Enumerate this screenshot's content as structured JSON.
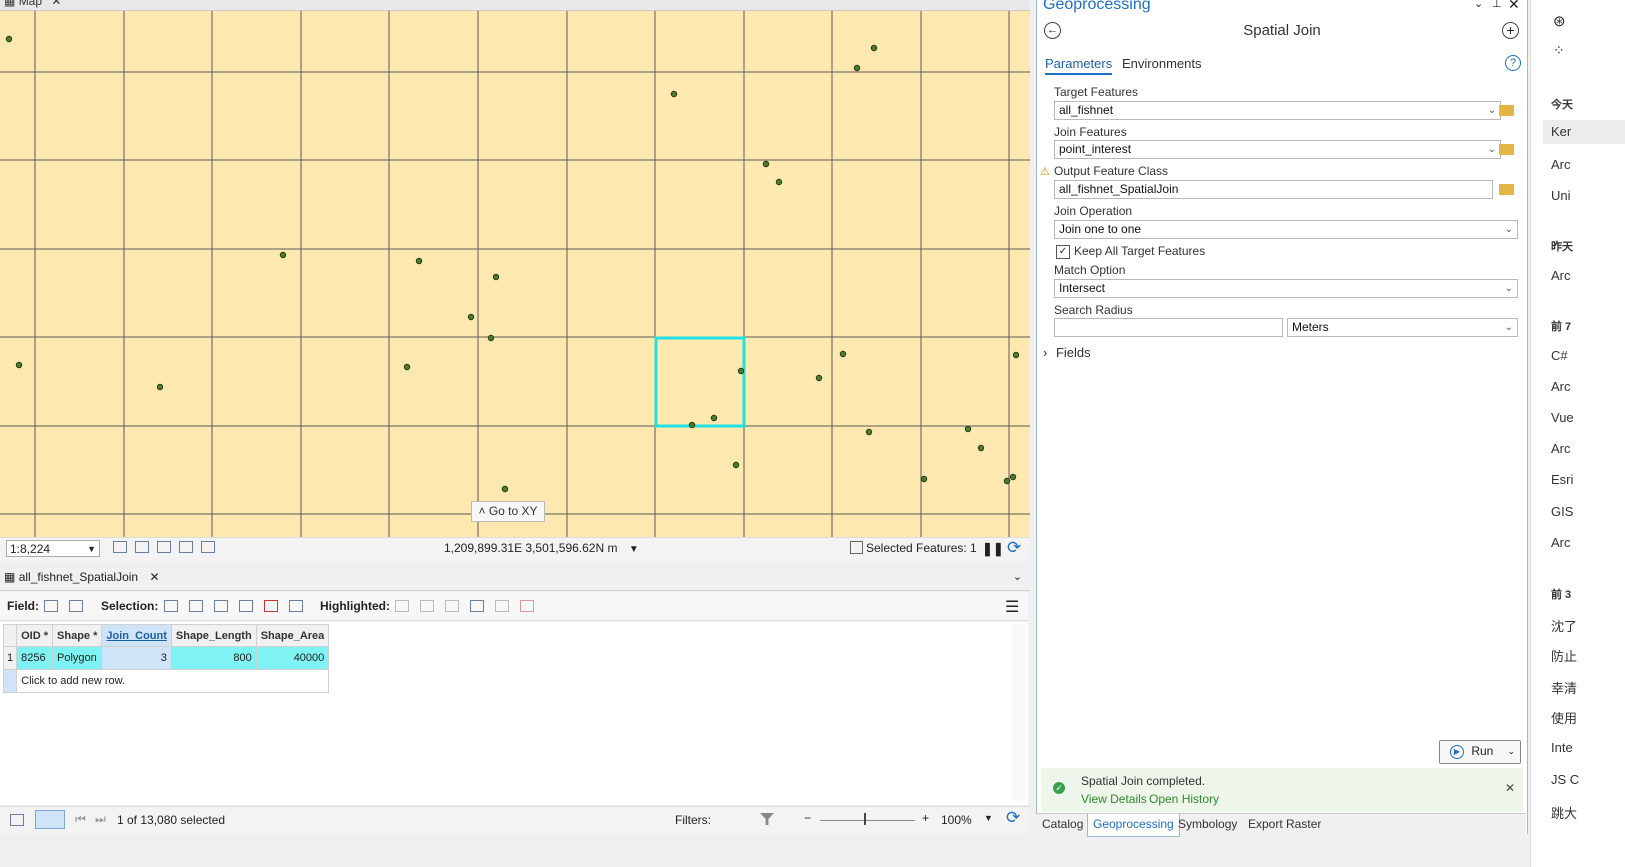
{
  "map": {
    "tab_label": "Map",
    "goto_xy": "Go to XY",
    "scale": "1:8,224",
    "coordinates": "1,209,899.31E 3,501,596.62N m",
    "selected_features": "Selected Features: 1"
  },
  "table": {
    "tab_label": "all_fishnet_SpatialJoin",
    "toolbar": {
      "field_label": "Field:",
      "selection_label": "Selection:",
      "highlighted_label": "Highlighted:"
    },
    "columns": [
      "OID *",
      "Shape *",
      "Join_Count",
      "Shape_Length",
      "Shape_Area"
    ],
    "rows": [
      {
        "index": "1",
        "oid": "8256",
        "shape": "Polygon",
        "join_count": "3",
        "shape_length": "800",
        "shape_area": "40000"
      }
    ],
    "add_row": "Click to add new row.",
    "status": {
      "selected": "1 of 13,080 selected",
      "filters_label": "Filters:",
      "zoom": "100%"
    }
  },
  "geoprocessing": {
    "title": "Geoprocessing",
    "tool_title": "Spatial Join",
    "tabs": [
      "Parameters",
      "Environments"
    ],
    "target_features": {
      "label": "Target Features",
      "value": "all_fishnet"
    },
    "join_features": {
      "label": "Join Features",
      "value": "point_interest"
    },
    "output_feature_class": {
      "label": "Output Feature Class",
      "value": "all_fishnet_SpatialJoin"
    },
    "join_operation": {
      "label": "Join Operation",
      "value": "Join one to one"
    },
    "keep_all": {
      "label": "Keep All Target Features",
      "checked": true
    },
    "match_option": {
      "label": "Match Option",
      "value": "Intersect"
    },
    "search_radius": {
      "label": "Search Radius",
      "value": "",
      "unit": "Meters"
    },
    "fields_label": "Fields",
    "run_label": "Run",
    "message": "Spatial Join completed.",
    "view_details": "View Details",
    "open_history": "Open History",
    "bottom_tabs": [
      "Catalog",
      "Geoprocessing",
      "Symbology",
      "Export Raster"
    ]
  },
  "right_panel": {
    "items": [
      "今天",
      "Ker",
      "Arc",
      "Uni",
      "昨天",
      "Arc",
      "前 7",
      "C#",
      "Arc",
      "Vue",
      "Arc",
      "Esri",
      "GIS",
      "Arc",
      "前 3",
      "沈了",
      "防止",
      "幸清",
      "使用",
      "Inte",
      "JS C",
      "跳大"
    ]
  },
  "colors": {
    "map_bg": "#fde8b0",
    "grid_line": "#5a5a5a",
    "selection": "#22e0e0",
    "point_fill": "#4a7a2a",
    "accent": "#1d6fc6"
  },
  "icons": [
    "map-icon",
    "close-icon",
    "chevron-up-icon",
    "back-arrow-icon",
    "add-icon",
    "help-icon",
    "folder-icon",
    "warning-icon",
    "check-icon",
    "run-icon",
    "menu-icon",
    "refresh-icon",
    "pause-icon",
    "table-icon",
    "success-icon"
  ]
}
